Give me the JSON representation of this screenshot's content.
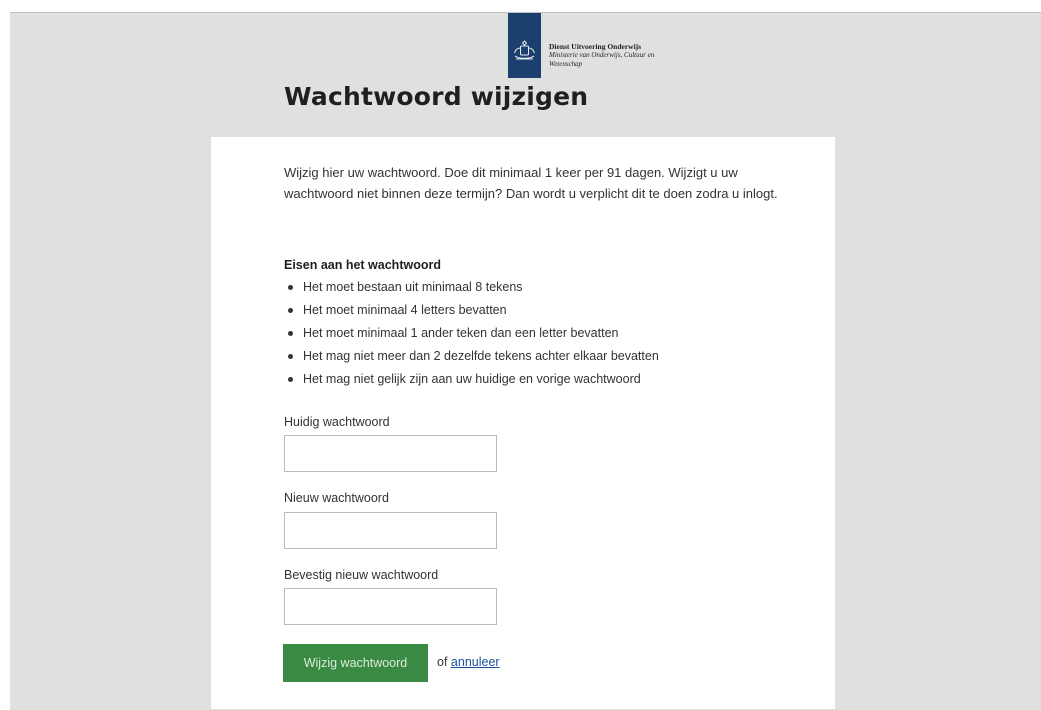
{
  "header": {
    "org_line1": "Dienst Uitvoering Onderwijs",
    "org_line2": "Ministerie van Onderwijs, Cultuur en",
    "org_line3": "Wetenschap",
    "logo_icon": "coat-of-arms-icon"
  },
  "page": {
    "title": "Wachtwoord wijzigen",
    "intro": "Wijzig hier uw wachtwoord. Doe dit minimaal 1 keer per 91 dagen. Wijzigt u uw wachtwoord niet binnen deze termijn? Dan wordt u verplicht dit te doen zodra u inlogt."
  },
  "requirements": {
    "title": "Eisen aan het wachtwoord",
    "items": [
      "Het moet bestaan uit minimaal 8 tekens",
      "Het moet minimaal 4 letters bevatten",
      "Het moet minimaal 1 ander teken dan een letter bevatten",
      "Het mag niet meer dan 2 dezelfde tekens achter elkaar bevatten",
      "Het mag niet gelijk zijn aan uw huidige en vorige wachtwoord"
    ]
  },
  "form": {
    "current_label": "Huidig wachtwoord",
    "current_value": "",
    "new_label": "Nieuw wachtwoord",
    "new_value": "",
    "confirm_label": "Bevestig nieuw wachtwoord",
    "confirm_value": "",
    "submit_label": "Wijzig wachtwoord",
    "or_text": "of",
    "cancel_label": "annuleer"
  },
  "colors": {
    "brand_blue": "#1b3f6e",
    "button_green": "#3a8a43",
    "link_blue": "#1b4f9c",
    "page_background": "#dfe1df"
  }
}
